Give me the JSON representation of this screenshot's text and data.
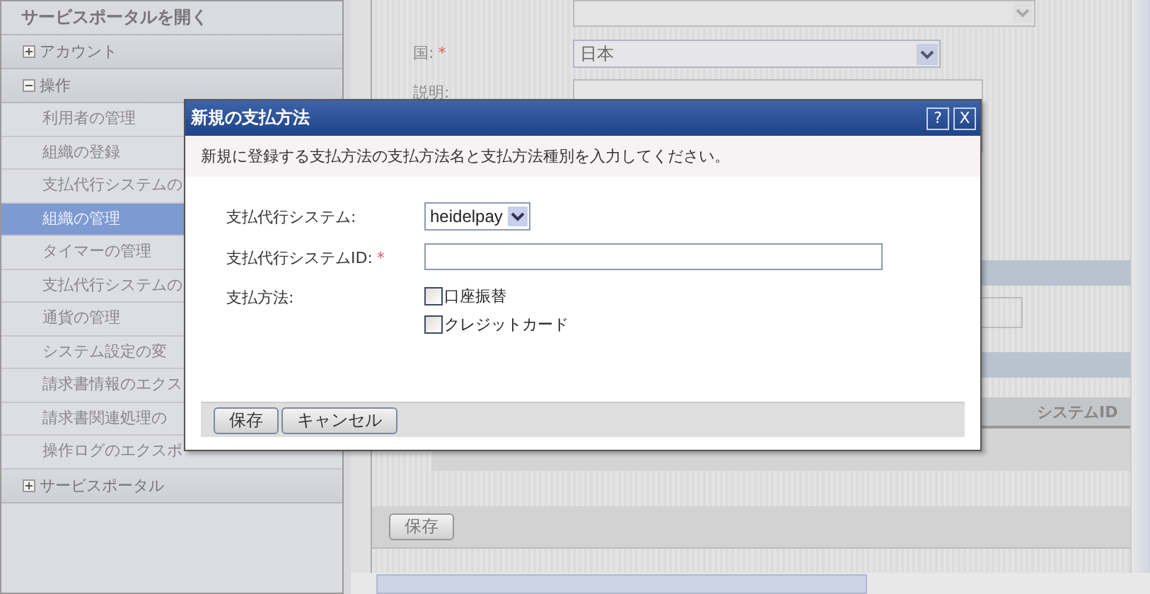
{
  "sidebar": {
    "header": "サービスポータルを開く",
    "groups": [
      {
        "label": "アカウント",
        "expanded": false
      },
      {
        "label": "操作",
        "expanded": true,
        "items": [
          {
            "label": "利用者の管理",
            "selected": false
          },
          {
            "label": "組織の登録",
            "selected": false
          },
          {
            "label": "支払代行システムの",
            "selected": false
          },
          {
            "label": "組織の管理",
            "selected": true
          },
          {
            "label": "タイマーの管理",
            "selected": false
          },
          {
            "label": "支払代行システムの",
            "selected": false
          },
          {
            "label": "通貨の管理",
            "selected": false
          },
          {
            "label": "システム設定の変",
            "selected": false
          },
          {
            "label": "請求書情報のエクス",
            "selected": false
          },
          {
            "label": "請求書関連処理の",
            "selected": false
          },
          {
            "label": "操作ログのエクスポ",
            "selected": false
          }
        ]
      },
      {
        "label": "サービスポータル",
        "expanded": false
      }
    ]
  },
  "page": {
    "fields": [
      {
        "kind": "select",
        "label": "国:",
        "required_mark": "*",
        "value": "日本"
      },
      {
        "kind": "textarea",
        "label": "説明:"
      }
    ],
    "table_header": "システムID",
    "save_button": "保存"
  },
  "dialog": {
    "title": "新規の支払方法",
    "help_button": "?",
    "close_button": "X",
    "instruction": "新規に登録する支払方法の支払方法名と支払方法種別を入力してください。",
    "fields": [
      {
        "kind": "select",
        "label": "支払代行システム:",
        "value": "heidelpay"
      },
      {
        "kind": "text",
        "label": "支払代行システムID:",
        "required_mark": "*"
      },
      {
        "kind": "checkboxes",
        "label": "支払方法:",
        "options": [
          {
            "label": "口座振替",
            "checked": false
          },
          {
            "label": "クレジットカード",
            "checked": false
          }
        ]
      }
    ],
    "buttons": [
      "保存",
      "キャンセル"
    ]
  }
}
